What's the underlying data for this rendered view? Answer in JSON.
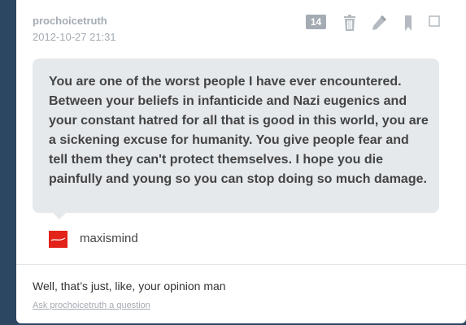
{
  "post": {
    "blog_name": "prochoicetruth",
    "timestamp": "2012-10-27 21:31",
    "note_count": "14",
    "icons": [
      "trash-icon",
      "edit-icon",
      "bookmark-icon",
      "select-checkbox"
    ]
  },
  "question": {
    "text": "You are one of the worst people I have ever encountered. Between your beliefs in infanticide and Nazi eugenics and your constant hatred for all that is good in this world, you are a sickening excuse for humanity. You give people fear and tell them they can't protect themselves. I hope you die painfully and young so you can stop doing so much damage.",
    "asker_name": "maxismind",
    "asker_avatar_icon": "asker-avatar-icon"
  },
  "answer": {
    "text": "Well, that’s just, like, your opinion man"
  },
  "footer": {
    "ask_link": "Ask prochoicetruth a question"
  },
  "colors": {
    "background": "#2c4762",
    "card": "#ffffff",
    "bubble": "#e6e9ec",
    "muted": "#a4abb3",
    "avatar": "#e2231a"
  }
}
